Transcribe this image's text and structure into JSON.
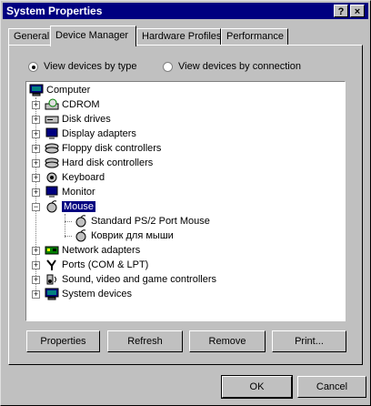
{
  "window": {
    "title": "System Properties",
    "help": "?",
    "close": "×"
  },
  "tabs": [
    "General",
    "Device Manager",
    "Hardware Profiles",
    "Performance"
  ],
  "view": {
    "by_type": "View devices by type",
    "by_connection": "View devices by connection"
  },
  "tree": {
    "root": "Computer",
    "items": [
      {
        "label": "CDROM",
        "icon": "cdrom-icon"
      },
      {
        "label": "Disk drives",
        "icon": "disk-drive-icon"
      },
      {
        "label": "Display adapters",
        "icon": "display-adapter-icon"
      },
      {
        "label": "Floppy disk controllers",
        "icon": "floppy-controller-icon"
      },
      {
        "label": "Hard disk controllers",
        "icon": "hdd-controller-icon"
      },
      {
        "label": "Keyboard",
        "icon": "keyboard-icon"
      },
      {
        "label": "Monitor",
        "icon": "monitor-icon"
      },
      {
        "label": "Mouse",
        "icon": "mouse-icon"
      },
      {
        "label": "Standard PS/2 Port Mouse",
        "icon": "mouse-icon"
      },
      {
        "label": "Коврик для мыши",
        "icon": "mouse-icon"
      },
      {
        "label": "Network adapters",
        "icon": "network-adapter-icon"
      },
      {
        "label": "Ports (COM & LPT)",
        "icon": "port-icon"
      },
      {
        "label": "Sound, video and game controllers",
        "icon": "sound-icon"
      },
      {
        "label": "System devices",
        "icon": "system-device-icon"
      }
    ]
  },
  "buttons": {
    "properties": "Properties",
    "refresh": "Refresh",
    "remove": "Remove",
    "print": "Print...",
    "ok": "OK",
    "cancel": "Cancel"
  },
  "colors": {
    "titlebar": "#000080",
    "face": "#c0c0c0",
    "selection": "#000080"
  }
}
